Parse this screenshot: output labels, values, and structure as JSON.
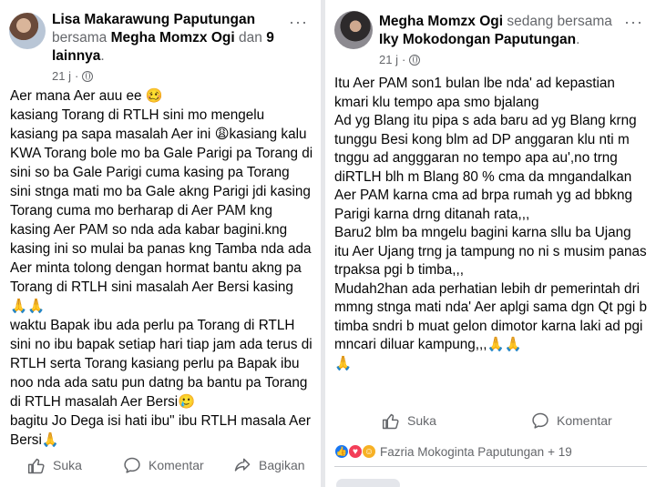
{
  "left_post": {
    "author": "Lisa Makarawung Paputungan",
    "with_word": "bersama",
    "tagged": "Megha Momzx Ogi",
    "and_word": "dan",
    "others": "9 lainnya",
    "time": "21 j",
    "separator": "·",
    "body": "Aer mana Aer auu ee 🥴\nkasiang Torang di RTLH sini mo mengelu kasiang pa sapa masalah Aer ini 😩kasiang kalu KWA Torang bole mo ba Gale Parigi pa Torang di sini so ba Gale Parigi cuma kasing pa Torang sini stnga mati mo ba Gale akng Parigi jdi kasing Torang cuma mo berharap di Aer PAM kng kasing Aer PAM so nda ada kabar bagini.kng kasing ini so mulai ba panas kng Tamba nda ada Aer minta tolong dengan hormat bantu akng pa Torang di RTLH sini masalah Aer Bersi kasing 🙏🙏\nwaktu Bapak ibu ada perlu pa Torang di RTLH sini no ibu bapak setiap hari tiap jam ada terus di RTLH serta Torang kasiang perlu pa Bapak ibu noo nda ada satu pun datng ba bantu pa Torang di RTLH masalah Aer Bersi🥲\nbagitu Jo Dega isi hati ibu\" ibu RTLH masala Aer Bersi🙏",
    "actions": {
      "like": "Suka",
      "comment": "Komentar",
      "share": "Bagikan"
    }
  },
  "right_post": {
    "author": "Megha Momzx Ogi",
    "with_word": "sedang bersama",
    "tagged": "Iky Mokodongan Paputungan",
    "time": "21 j",
    "separator": "·",
    "body": "Itu Aer PAM son1 bulan lbe nda' ad kepastian kmari klu tempo apa smo bjalang\nAd yg Blang itu pipa s ada baru ad yg Blang krng tunggu Besi kong blm ad DP anggaran klu nti m tnggu ad angggaran no tempo apa au',no trng diRTLH blh m Blang 80 % cma da mngandalkan Aer PAM karna cma ad brpa rumah yg ad bbkng Parigi karna drng ditanah rata,,,\nBaru2 blm ba mngelu bagini karna sllu ba Ujang itu Aer Ujang trng ja tampung no ni s musim panas trpaksa pgi b timba,,,\nMudah2han ada perhatian lebih dr pemerintah dri mmng stnga mati nda' Aer aplgi sama dgn Qt pgi b timba sndri b muat gelon dimotor karna laki ad pgi mncari diluar kampung,,,🙏🙏\n🙏",
    "actions": {
      "like": "Suka",
      "comment": "Komentar"
    },
    "reactions": {
      "names": "Fazria Mokoginta Paputungan",
      "more": "+ 19"
    }
  },
  "colors": {
    "muted": "#65676b",
    "like_blue": "#1877f2",
    "love_red": "#f33e58",
    "care_yellow": "#f7b125",
    "divider": "#e6e7ea"
  },
  "icons": {
    "like": "thumb-up-icon",
    "comment": "speech-bubble-icon",
    "share": "share-arrow-icon",
    "privacy": "globe-icon",
    "menu": "ellipsis-icon"
  }
}
